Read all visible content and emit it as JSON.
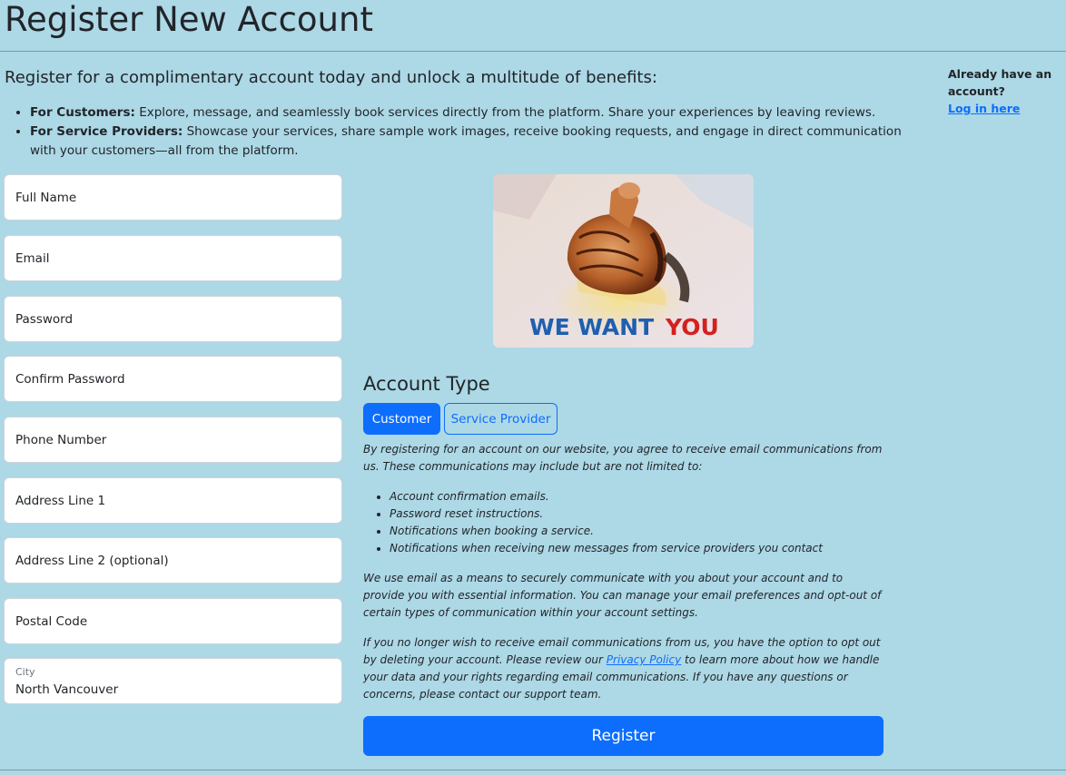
{
  "page": {
    "title": "Register New Account"
  },
  "intro": {
    "heading": "Register for a complimentary account today and unlock a multitude of benefits:",
    "benefits": [
      {
        "label": "For Customers:",
        "text": " Explore, message, and seamlessly book services directly from the platform. Share your experiences by leaving reviews."
      },
      {
        "label": "For Service Providers:",
        "text": " Showcase your services, share sample work images, receive booking requests, and engage in direct communication with your customers—all from the platform."
      }
    ]
  },
  "login": {
    "prompt": "Already have an account?",
    "link": "Log in here"
  },
  "form": {
    "full_name": {
      "placeholder": "Full Name"
    },
    "email": {
      "placeholder": "Email"
    },
    "password": {
      "placeholder": "Password"
    },
    "confirm_password": {
      "placeholder": "Confirm Password"
    },
    "phone": {
      "placeholder": "Phone Number"
    },
    "address1": {
      "placeholder": "Address Line 1"
    },
    "address2": {
      "placeholder": "Address Line 2 (optional)"
    },
    "postal_code": {
      "placeholder": "Postal Code"
    },
    "city": {
      "label": "City",
      "value": "North Vancouver"
    }
  },
  "hero": {
    "caption_blue": "WE WANT",
    "caption_red": "YOU"
  },
  "account_type": {
    "title": "Account Type",
    "options": [
      "Customer",
      "Service Provider"
    ],
    "selected": "Customer"
  },
  "notice": {
    "intro": "By registering for an account on our website, you agree to receive email communications from us. These communications may include but are not limited to:",
    "items": [
      "Account confirmation emails.",
      "Password reset instructions.",
      "Notifications when booking a service.",
      "Notifications when receiving new messages from service providers you contact"
    ],
    "paragraph2": "We use email as a means to securely communicate with you about your account and to provide you with essential information. You can manage your email preferences and opt-out of certain types of communication within your account settings.",
    "p3_before": "If you no longer wish to receive email communications from us, you have the option to opt out by deleting your account. Please review our ",
    "p3_link": "Privacy Policy",
    "p3_after": " to learn more about how we handle your data and your rights regarding email communications. If you have any questions or concerns, please contact our support team."
  },
  "actions": {
    "register": "Register"
  },
  "colors": {
    "background": "#add8e6",
    "primary": "#0d6efd",
    "caption_blue": "#1f5fb0",
    "caption_red": "#d42020"
  }
}
